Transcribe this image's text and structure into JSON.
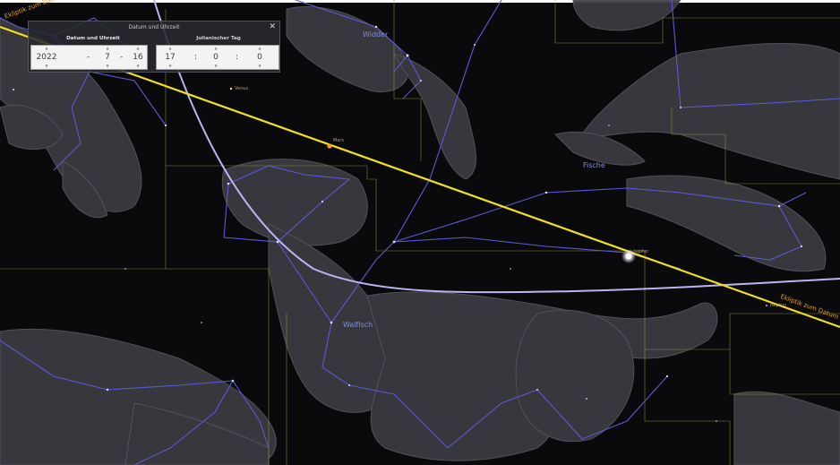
{
  "dialog": {
    "title": "Datum und Uhrzeit",
    "close_label": "✕",
    "tab_date": "Datum und Uhrzeit",
    "tab_jd": "Julianischer Tag",
    "year": "2022",
    "month": "7",
    "day": "16",
    "hour": "17",
    "minute": "0",
    "second": "0",
    "date_separator": "-",
    "time_separator": ":",
    "spin_up": "▲",
    "spin_down": "▼"
  },
  "sky": {
    "constellations": {
      "widder": "Widder",
      "fische": "Fische",
      "walfisch": "Walfisch"
    },
    "planets": {
      "venus": "Venus",
      "mars": "Mars",
      "jupiter": "Jupiter",
      "neptun": "Neptun"
    },
    "ecliptic_left": "Ekliptik zum Datum",
    "ecliptic_right": "Ekliptik zum Datum"
  },
  "colors": {
    "ecliptic": "#f2e21a",
    "equator": "#b9b6f0",
    "lines": "#5a5ad6",
    "boundaries": "#a0a03a",
    "mars": "#ff9a2a",
    "jupiter": "#ffffff"
  }
}
